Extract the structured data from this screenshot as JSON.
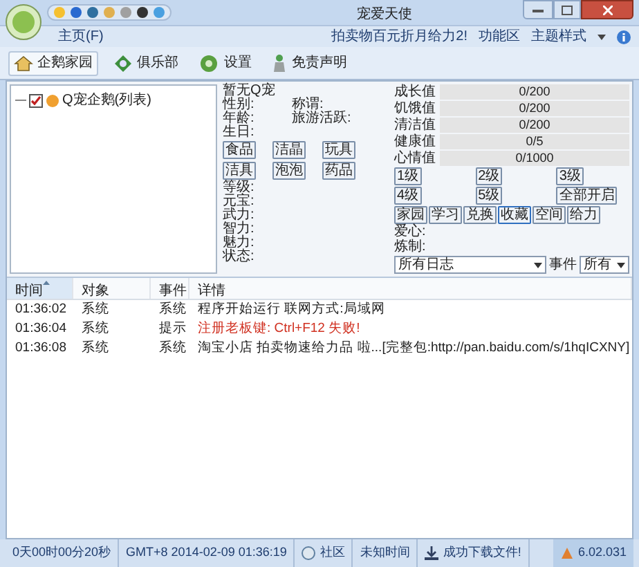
{
  "window": {
    "title": "宠爱天使"
  },
  "menu": {
    "tabs": [
      {
        "label": "主页(F)",
        "selected": true
      }
    ],
    "right_items": [
      "拍卖物百元折月给力2!",
      "功能区",
      "主题样式"
    ]
  },
  "toolbar": [
    {
      "label": "企鹅家园",
      "kind": "home"
    },
    {
      "label": "俱乐部",
      "kind": "club"
    },
    {
      "label": "设置",
      "kind": "settings"
    },
    {
      "label": "免责声明",
      "kind": "notice"
    }
  ],
  "tree": {
    "items": [
      {
        "label": "Q宠企鹅(列表)",
        "checked": true
      }
    ]
  },
  "pet": {
    "title": "暂无Q宠",
    "top_fields": [
      {
        "label": "性别:",
        "extra": "称谓:"
      },
      {
        "label": "年龄:",
        "extra": "旅游活跃:"
      },
      {
        "label": "生日:"
      }
    ],
    "item_buttons": [
      [
        "食品",
        "洁晶",
        "玩具"
      ],
      [
        "洁具",
        "泡泡",
        "药品"
      ]
    ],
    "fields": [
      "等级:",
      "元宝:",
      "武力:",
      "智力:",
      "魅力:",
      "状态:"
    ]
  },
  "stats": [
    {
      "label": "成长值",
      "reading": "0/200",
      "level": 0
    },
    {
      "label": "饥饿值",
      "reading": "0/200",
      "level": 0
    },
    {
      "label": "清洁值",
      "reading": "0/200",
      "level": 0
    },
    {
      "label": "健康值",
      "reading": "0/5",
      "level": 0
    },
    {
      "label": "心情值",
      "reading": "0/1000",
      "level": 0
    }
  ],
  "level_buttons": [
    "1级",
    "2级",
    "3级",
    "4级",
    "5级",
    "全部开启"
  ],
  "actions": [
    {
      "label": "家园",
      "selected": false
    },
    {
      "label": "学习",
      "selected": false
    },
    {
      "label": "兑换",
      "selected": false
    },
    {
      "label": "收藏",
      "selected": true
    },
    {
      "label": "空间",
      "selected": false
    },
    {
      "label": "给力",
      "selected": false
    }
  ],
  "extra_fields": [
    "爱心:",
    "炼制:"
  ],
  "filters": {
    "log": "所有日志",
    "event_label": "事件",
    "event": "所有"
  },
  "log": {
    "columns": [
      {
        "label": "时间",
        "sorted": true
      },
      {
        "label": "对象",
        "sorted": false
      },
      {
        "label": "事件",
        "sorted": false
      },
      {
        "label": "详情",
        "sorted": false
      }
    ],
    "rows": [
      {
        "kind": "normal",
        "cells": [
          "01:36:02",
          "系统",
          "系统",
          "程序开始运行 联网方式:局域网"
        ]
      },
      {
        "kind": "warning",
        "cells": [
          "01:36:04",
          "系统",
          "提示",
          "注册老板键: Ctrl+F12 失败!"
        ]
      },
      {
        "kind": "normal",
        "cells": [
          "01:36:08",
          "系统",
          "系统",
          "淘宝小店 拍卖物速给力品 啦...[完整包:http://pan.baidu.com/s/1hqICXNY]"
        ]
      }
    ]
  },
  "status_bar": [
    {
      "kind": "plain",
      "text": "0天00时00分20秒"
    },
    {
      "kind": "plain",
      "text": "GMT+8 2014-02-09 01:36:19"
    },
    {
      "kind": "community",
      "text": "社区"
    },
    {
      "kind": "plain",
      "text": "未知时间"
    },
    {
      "kind": "download",
      "text": "成功下载文件!"
    },
    {
      "kind": "version",
      "text": "6.02.031"
    }
  ]
}
